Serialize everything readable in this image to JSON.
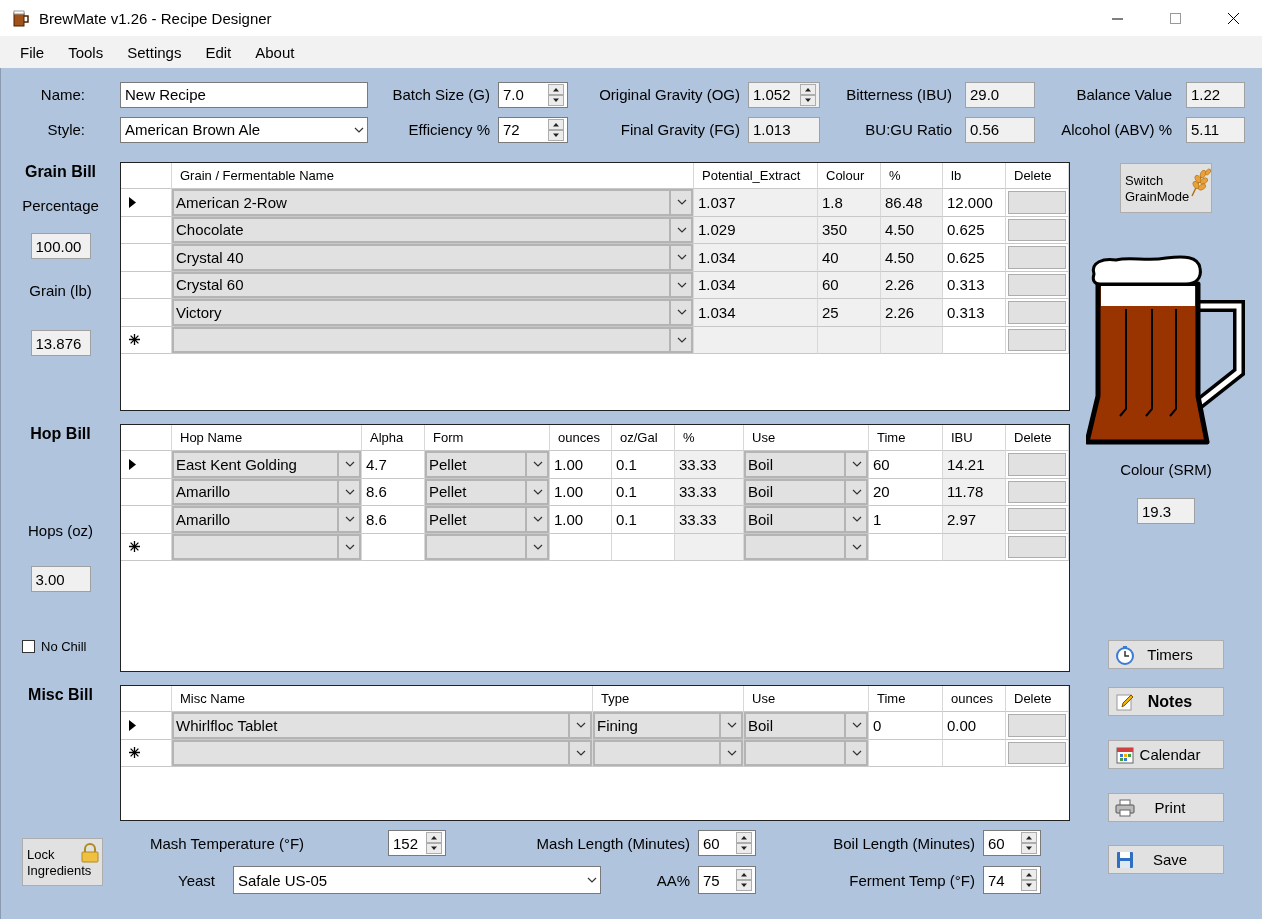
{
  "window": {
    "title": "BrewMate v1.26 - Recipe Designer"
  },
  "menu": [
    {
      "label": "File"
    },
    {
      "label": "Tools"
    },
    {
      "label": "Settings"
    },
    {
      "label": "Edit"
    },
    {
      "label": "About"
    }
  ],
  "recipe_fields": [
    {
      "label": "Name:",
      "kind": "text",
      "value": "New Recipe"
    },
    {
      "label": "Batch Size (G)",
      "kind": "spin",
      "value": "7.0",
      "readonly": false
    },
    {
      "label": "Original Gravity (OG)",
      "kind": "spin",
      "value": "1.052",
      "readonly": true
    },
    {
      "label": "Bitterness (IBU)",
      "kind": "readonly",
      "value": "29.0"
    },
    {
      "label": "Balance Value",
      "kind": "readonly",
      "value": "1.22"
    },
    {
      "label": "Style:",
      "kind": "combo",
      "value": "American Brown Ale"
    },
    {
      "label": "Efficiency %",
      "kind": "spin",
      "value": "72",
      "readonly": false
    },
    {
      "label": "Final Gravity (FG)",
      "kind": "readonly",
      "value": "1.013"
    },
    {
      "label": "BU:GU Ratio",
      "kind": "readonly",
      "value": "0.56"
    },
    {
      "label": "Alcohol (ABV) %",
      "kind": "readonly",
      "value": "5.11"
    }
  ],
  "sections": [
    {
      "side": [
        {
          "kind": "heading",
          "text": "Grain Bill"
        },
        {
          "kind": "label",
          "text": "Percentage"
        },
        {
          "kind": "readonly",
          "text": "100.00"
        },
        {
          "kind": "label",
          "text": "Grain (lb)"
        },
        {
          "kind": "readonly",
          "text": "13.876"
        }
      ],
      "table": {
        "columns": [
          {
            "title": "Grain / Fermentable Name",
            "kind": "combo"
          },
          {
            "title": "Potential_Extract",
            "kind": "readonly"
          },
          {
            "title": "Colour",
            "kind": "readonly"
          },
          {
            "title": "%",
            "kind": "readonly"
          },
          {
            "title": "lb",
            "kind": "text"
          },
          {
            "title": "Delete",
            "kind": "button"
          }
        ],
        "rows": [
          {
            "current": true,
            "cells": [
              "American 2-Row",
              "1.037",
              "1.8",
              "86.48",
              "12.000"
            ]
          },
          {
            "current": false,
            "cells": [
              "Chocolate",
              "1.029",
              "350",
              "4.50",
              "0.625"
            ]
          },
          {
            "current": false,
            "cells": [
              "Crystal 40",
              "1.034",
              "40",
              "4.50",
              "0.625"
            ]
          },
          {
            "current": false,
            "cells": [
              "Crystal 60",
              "1.034",
              "60",
              "2.26",
              "0.313"
            ]
          },
          {
            "current": false,
            "cells": [
              "Victory",
              "1.034",
              "25",
              "2.26",
              "0.313"
            ]
          }
        ],
        "new_row": true
      }
    },
    {
      "side": [
        {
          "kind": "heading",
          "text": "Hop Bill"
        },
        {
          "kind": "label",
          "text": "Hops (oz)"
        },
        {
          "kind": "readonly",
          "text": "3.00"
        },
        {
          "kind": "checkbox",
          "text": "No Chill",
          "checked": false
        }
      ],
      "table": {
        "columns": [
          {
            "title": "Hop Name",
            "kind": "combo"
          },
          {
            "title": "Alpha",
            "kind": "text"
          },
          {
            "title": "Form",
            "kind": "combo"
          },
          {
            "title": "ounces",
            "kind": "text"
          },
          {
            "title": "oz/Gal",
            "kind": "text"
          },
          {
            "title": "%",
            "kind": "readonly"
          },
          {
            "title": "Use",
            "kind": "combo"
          },
          {
            "title": "Time",
            "kind": "text"
          },
          {
            "title": "IBU",
            "kind": "readonly"
          },
          {
            "title": "Delete",
            "kind": "button"
          }
        ],
        "rows": [
          {
            "current": true,
            "cells": [
              "East Kent Golding",
              "4.7",
              "Pellet",
              "1.00",
              "0.1",
              "33.33",
              "Boil",
              "60",
              "14.21"
            ]
          },
          {
            "current": false,
            "cells": [
              "Amarillo",
              "8.6",
              "Pellet",
              "1.00",
              "0.1",
              "33.33",
              "Boil",
              "20",
              "11.78"
            ]
          },
          {
            "current": false,
            "cells": [
              "Amarillo",
              "8.6",
              "Pellet",
              "1.00",
              "0.1",
              "33.33",
              "Boil",
              "1",
              "2.97"
            ]
          }
        ],
        "new_row": true
      }
    },
    {
      "side": [
        {
          "kind": "heading",
          "text": "Misc Bill"
        }
      ],
      "table": {
        "columns": [
          {
            "title": "Misc Name",
            "kind": "combo"
          },
          {
            "title": "Type",
            "kind": "combo"
          },
          {
            "title": "Use",
            "kind": "combo"
          },
          {
            "title": "Time",
            "kind": "text"
          },
          {
            "title": "ounces",
            "kind": "text"
          },
          {
            "title": "Delete",
            "kind": "button"
          }
        ],
        "rows": [
          {
            "current": true,
            "cells": [
              "Whirlfloc Tablet",
              "Fining",
              "Boil",
              "0",
              "0.00"
            ]
          }
        ],
        "new_row": true
      }
    }
  ],
  "lock_button": {
    "label": "Lock Ingredients"
  },
  "process_fields": [
    {
      "label": "Mash Temperature (°F)",
      "kind": "spin",
      "value": "152"
    },
    {
      "label": "Mash Length (Minutes)",
      "kind": "spin",
      "value": "60"
    },
    {
      "label": "Boil Length (Minutes)",
      "kind": "spin",
      "value": "60"
    },
    {
      "label": "Yeast",
      "kind": "combo",
      "value": "Safale US-05"
    },
    {
      "label": "AA%",
      "kind": "spin",
      "value": "75"
    },
    {
      "label": "Ferment Temp (°F)",
      "kind": "spin",
      "value": "74"
    }
  ],
  "switch_button": {
    "label": "Switch GrainMode"
  },
  "colour": {
    "label": "Colour (SRM)",
    "value": "19.3"
  },
  "side_buttons": [
    {
      "label": "Timers",
      "bold": false
    },
    {
      "label": "Notes",
      "bold": true
    },
    {
      "label": "Calendar",
      "bold": false
    },
    {
      "label": "Print",
      "bold": false
    },
    {
      "label": "Save",
      "bold": false
    }
  ]
}
